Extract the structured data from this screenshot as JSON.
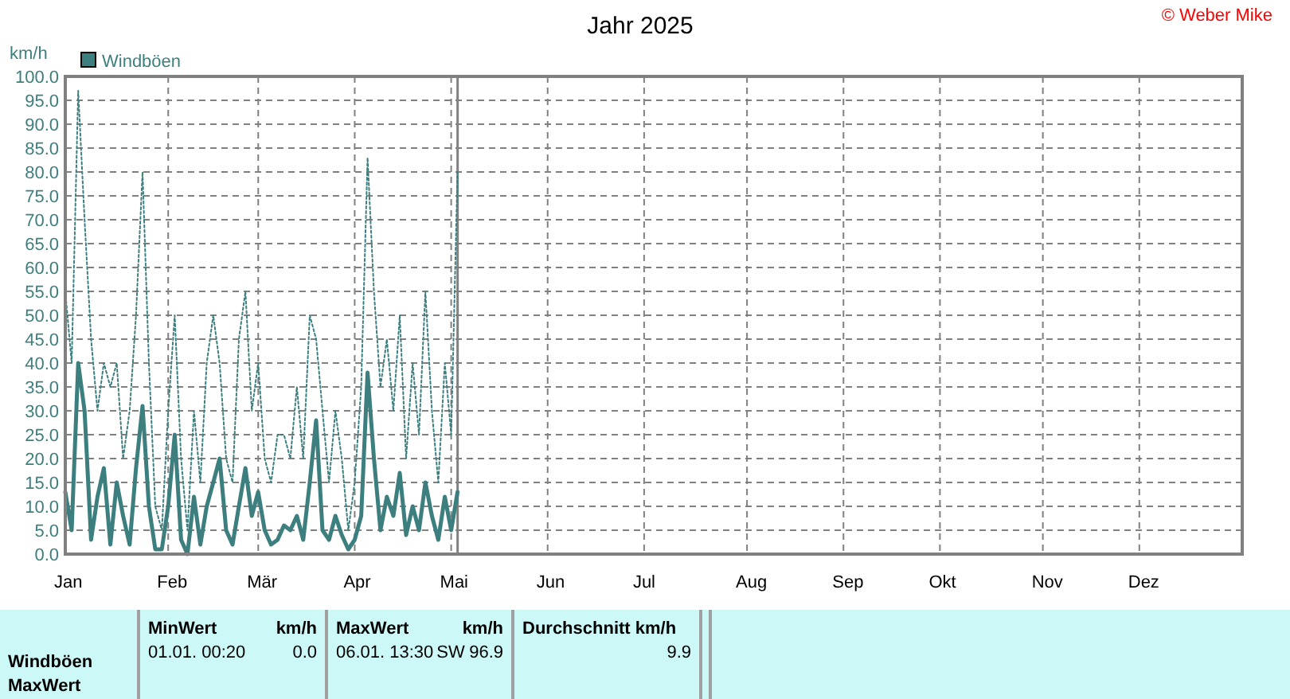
{
  "copyright": "© Weber Mike",
  "chart": {
    "chart_data": {
      "type": "line",
      "title": "Jahr 2025",
      "ylabel": "km/h",
      "ylim": [
        0,
        100
      ],
      "yticks": [
        {
          "value": 0,
          "label": "0.0"
        },
        {
          "value": 5,
          "label": "5.0"
        },
        {
          "value": 10,
          "label": "10.0"
        },
        {
          "value": 15,
          "label": "15.0"
        },
        {
          "value": 20,
          "label": "20.0"
        },
        {
          "value": 25,
          "label": "25.0"
        },
        {
          "value": 30,
          "label": "30.0"
        },
        {
          "value": 35,
          "label": "35.0"
        },
        {
          "value": 40,
          "label": "40.0"
        },
        {
          "value": 45,
          "label": "45.0"
        },
        {
          "value": 50,
          "label": "50.0"
        },
        {
          "value": 55,
          "label": "55.0"
        },
        {
          "value": 60,
          "label": "60.0"
        },
        {
          "value": 65,
          "label": "65.0"
        },
        {
          "value": 70,
          "label": "70.0"
        },
        {
          "value": 75,
          "label": "75.0"
        },
        {
          "value": 80,
          "label": "80.0"
        },
        {
          "value": 85,
          "label": "85.0"
        },
        {
          "value": 90,
          "label": "90.0"
        },
        {
          "value": 95,
          "label": "95.0"
        },
        {
          "value": 100,
          "label": "100.0"
        }
      ],
      "categories": [
        "Jan",
        null,
        null,
        null,
        null,
        null,
        null,
        null,
        null,
        null,
        null,
        null,
        null,
        null,
        null,
        null,
        "Feb",
        null,
        null,
        null,
        null,
        null,
        null,
        null,
        null,
        null,
        null,
        null,
        null,
        null,
        "Mär",
        null,
        null,
        null,
        null,
        null,
        null,
        null,
        null,
        null,
        null,
        null,
        null,
        null,
        null,
        "Apr",
        null,
        null,
        null,
        null,
        null,
        null,
        null,
        null,
        null,
        null,
        null,
        null,
        null,
        null,
        "Mai",
        null,
        null,
        null,
        null,
        null,
        null,
        null,
        null,
        null,
        null,
        null,
        null,
        null,
        null,
        "Jun",
        null,
        null,
        null,
        null,
        null,
        null,
        null,
        null,
        null,
        null,
        null,
        null,
        null,
        null,
        "Jul",
        null,
        null,
        null,
        null,
        null,
        null,
        null,
        null,
        null,
        null,
        null,
        null,
        null,
        null,
        null,
        "Aug",
        null,
        null,
        null,
        null,
        null,
        null,
        null,
        null,
        null,
        null,
        null,
        null,
        null,
        null,
        "Sep",
        null,
        null,
        null,
        null,
        null,
        null,
        null,
        null,
        null,
        null,
        null,
        null,
        null,
        null,
        "Okt",
        null,
        null,
        null,
        null,
        null,
        null,
        null,
        null,
        null,
        null,
        null,
        null,
        null,
        null,
        null,
        "Nov",
        null,
        null,
        null,
        null,
        null,
        null,
        null,
        null,
        null,
        null,
        null,
        null,
        null,
        null,
        "Dez",
        null,
        null,
        null,
        null,
        null,
        null,
        null,
        null,
        null,
        null,
        null,
        null,
        null,
        null,
        null
      ],
      "series": [
        {
          "name": "Windböen",
          "color": "#3d7f7f",
          "line_style": "solid",
          "values": [
            13,
            5,
            40,
            30,
            3,
            12,
            18,
            2,
            15,
            8,
            2,
            18,
            31,
            10,
            1,
            1,
            10,
            25,
            3,
            0,
            12,
            2,
            10,
            15,
            20,
            5,
            2,
            10,
            18,
            8,
            13,
            5,
            2,
            3,
            6,
            5,
            8,
            3,
            15,
            28,
            5,
            3,
            8,
            4,
            1,
            3,
            8,
            38,
            20,
            5,
            12,
            8,
            17,
            4,
            10,
            5,
            15,
            8,
            3,
            12,
            5,
            13,
            null,
            null,
            null,
            null,
            null,
            null,
            null,
            null,
            null,
            null,
            null,
            null,
            null,
            null,
            null,
            null,
            null,
            null,
            null,
            null,
            null,
            null,
            null,
            null,
            null,
            null,
            null,
            null,
            null,
            null,
            null,
            null,
            null,
            null,
            null,
            null,
            null,
            null,
            null,
            null,
            null,
            null,
            null,
            null,
            null,
            null,
            null,
            null,
            null,
            null,
            null,
            null,
            null,
            null,
            null,
            null,
            null,
            null,
            null,
            null,
            null,
            null,
            null,
            null,
            null,
            null,
            null,
            null,
            null,
            null,
            null,
            null,
            null,
            null,
            null,
            null,
            null,
            null,
            null,
            null,
            null,
            null,
            null,
            null,
            null,
            null,
            null,
            null,
            null,
            null,
            null,
            null,
            null,
            null,
            null,
            null,
            null,
            null,
            null,
            null,
            null,
            null,
            null,
            null,
            null,
            null,
            null,
            null,
            null,
            null,
            null,
            null,
            null,
            null,
            null,
            null,
            null,
            null,
            null,
            null,
            null
          ]
        },
        {
          "color": "#3d7f7f",
          "line_style": "dashed",
          "values": [
            55,
            40,
            97,
            70,
            45,
            30,
            40,
            35,
            40,
            20,
            30,
            50,
            80,
            40,
            10,
            5,
            30,
            50,
            20,
            5,
            30,
            15,
            40,
            50,
            40,
            20,
            15,
            45,
            55,
            30,
            40,
            20,
            15,
            25,
            25,
            20,
            35,
            20,
            50,
            45,
            30,
            15,
            30,
            20,
            5,
            15,
            35,
            83,
            55,
            35,
            45,
            30,
            50,
            20,
            40,
            25,
            55,
            30,
            15,
            40,
            25,
            80,
            null,
            null,
            null,
            null,
            null,
            null,
            null,
            null,
            null,
            null,
            null,
            null,
            null,
            null,
            null,
            null,
            null,
            null,
            null,
            null,
            null,
            null,
            null,
            null,
            null,
            null,
            null,
            null,
            null,
            null,
            null,
            null,
            null,
            null,
            null,
            null,
            null,
            null,
            null,
            null,
            null,
            null,
            null,
            null,
            null,
            null,
            null,
            null,
            null,
            null,
            null,
            null,
            null,
            null,
            null,
            null,
            null,
            null,
            null,
            null,
            null,
            null,
            null,
            null,
            null,
            null,
            null,
            null,
            null,
            null,
            null,
            null,
            null,
            null,
            null,
            null,
            null,
            null,
            null,
            null,
            null,
            null,
            null,
            null,
            null,
            null,
            null,
            null,
            null,
            null,
            null,
            null,
            null,
            null,
            null,
            null,
            null,
            null,
            null,
            null,
            null,
            null,
            null,
            null,
            null,
            null,
            null,
            null,
            null,
            null,
            null,
            null,
            null,
            null,
            null,
            null,
            null,
            null,
            null,
            null,
            null
          ]
        }
      ],
      "stacked": false,
      "grid": true
    }
  },
  "table": {
    "row_label": [
      "Windböen",
      "MaxWert"
    ],
    "columns": [
      {
        "title": "MinWert",
        "unit": "km/h",
        "date": "01.01.  00:20",
        "value": "0.0"
      },
      {
        "title": "MaxWert",
        "unit": "km/h",
        "date": "06.01.  13:30",
        "direction": "SW",
        "value": "96.9"
      },
      {
        "title": "Durchschnitt km/h",
        "value": "9.9"
      }
    ]
  }
}
